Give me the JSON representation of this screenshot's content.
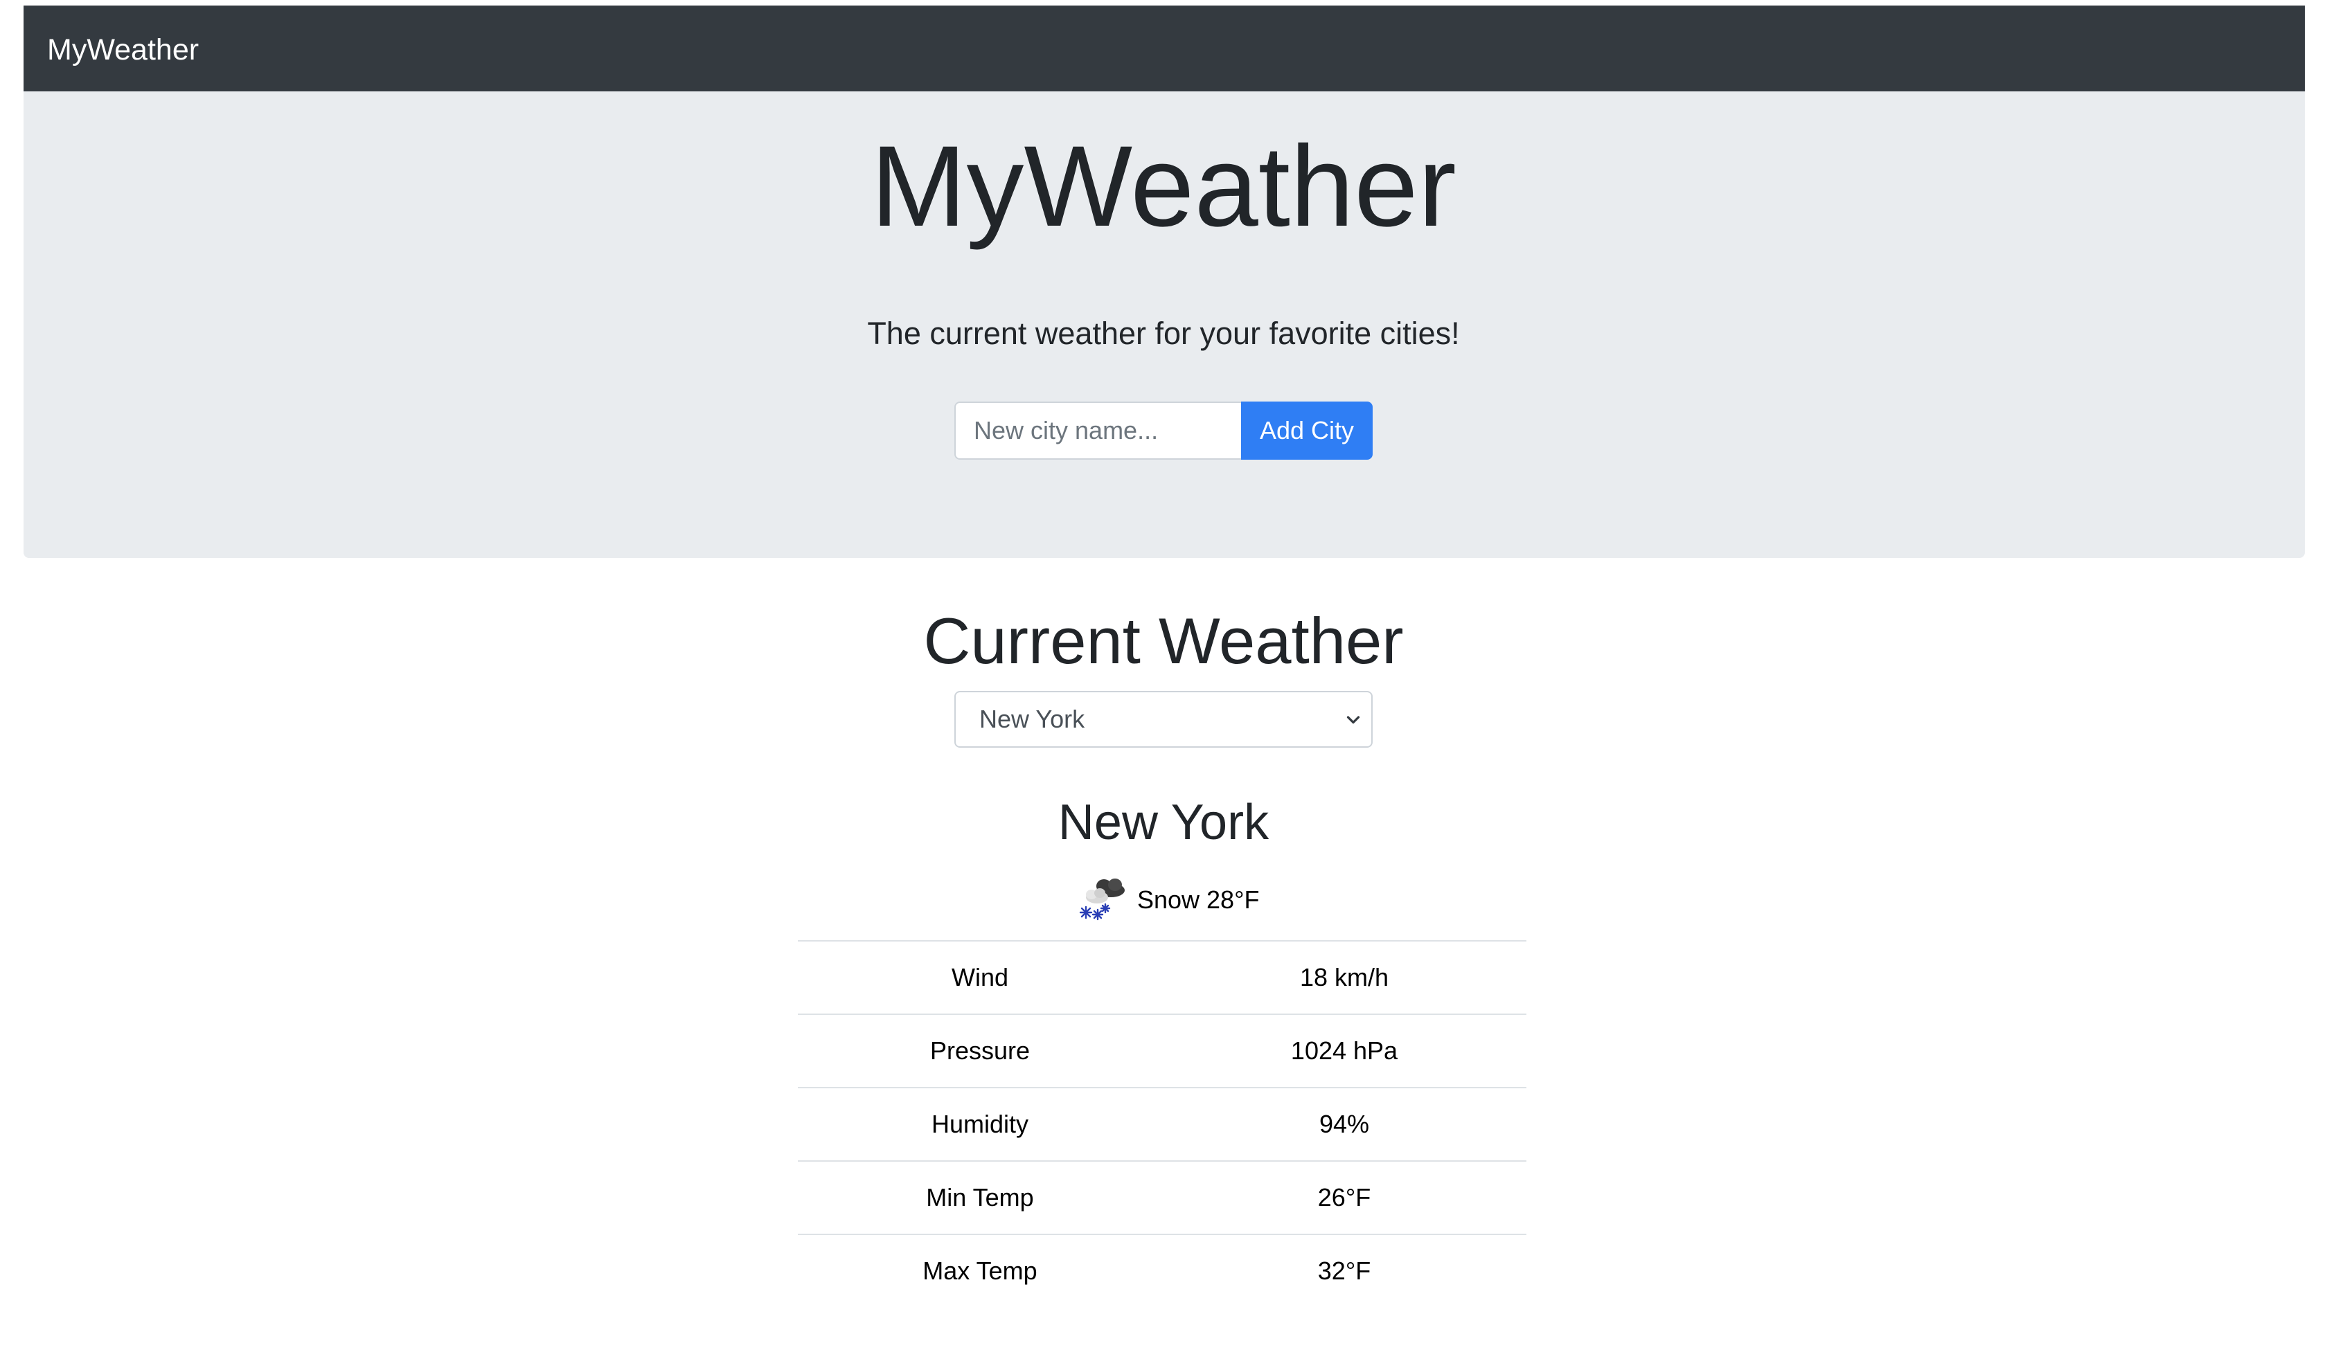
{
  "navbar": {
    "brand": "MyWeather"
  },
  "hero": {
    "title": "MyWeather",
    "subtitle": "The current weather for your favorite cities!",
    "city_input_placeholder": "New city name...",
    "city_input_value": "",
    "add_button_label": "Add City"
  },
  "current": {
    "section_title": "Current Weather",
    "selected_city": "New York",
    "city_name": "New York",
    "condition": "Snow 28°F",
    "condition_icon": "snow-cloud-icon",
    "stats": [
      {
        "label": "Wind",
        "value": "18 km/h"
      },
      {
        "label": "Pressure",
        "value": "1024 hPa"
      },
      {
        "label": "Humidity",
        "value": "94%"
      },
      {
        "label": "Min Temp",
        "value": "26°F"
      },
      {
        "label": "Max Temp",
        "value": "32°F"
      }
    ]
  },
  "colors": {
    "navbar_bg": "#343a40",
    "jumbotron_bg": "#e9ecef",
    "primary_button": "#2f7ef4"
  }
}
